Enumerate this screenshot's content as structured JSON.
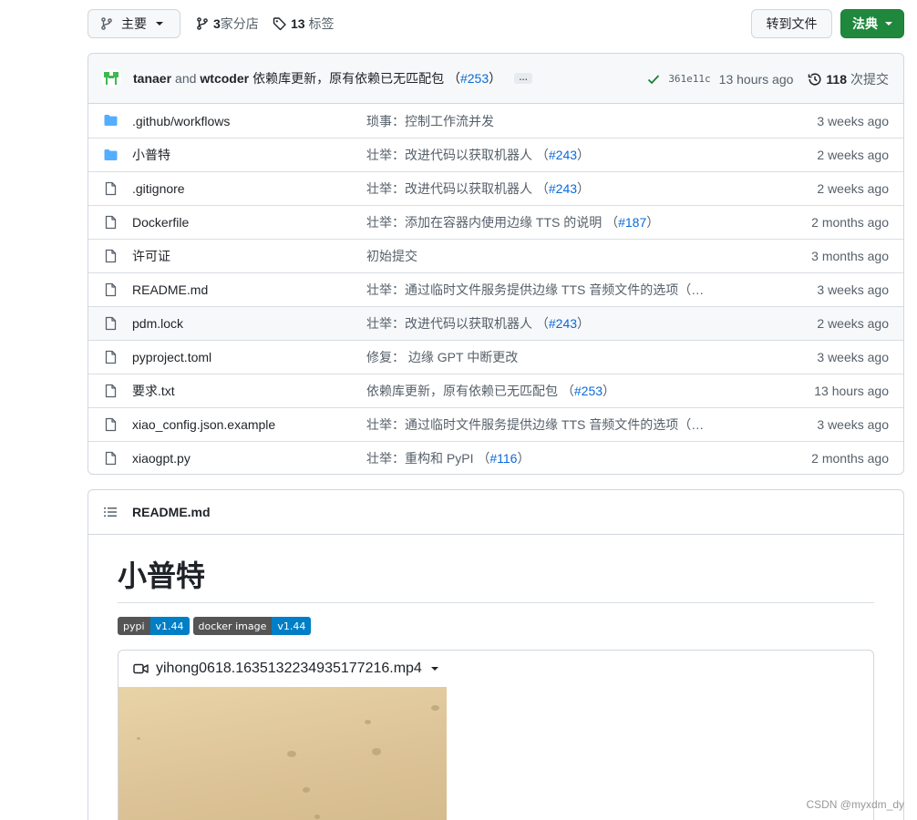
{
  "topbar": {
    "branch_label": "主要",
    "branches_count": "3",
    "branches_label": "家分店",
    "tags_count": "13",
    "tags_label": "标签",
    "goto_file_label": "转到文件",
    "code_label": "法典"
  },
  "commit": {
    "author1": "tanaer",
    "and": "and",
    "author2": "wtcoder",
    "message": "依赖库更新，原有依赖已无匹配包",
    "pr": "#253",
    "sha": "361e11c",
    "time": "13 hours ago",
    "history_count": "118",
    "history_label": "次提交"
  },
  "files": [
    {
      "type": "dir",
      "name": ".github/workflows",
      "msg": "琐事：控制工作流并发",
      "pr": "",
      "time": "3 weeks ago"
    },
    {
      "type": "dir",
      "name": "小普特",
      "msg": "壮举：改进代码以获取机器人 ",
      "pr": "#243",
      "time": "2 weeks ago"
    },
    {
      "type": "file",
      "name": ".gitignore",
      "msg": "壮举：改进代码以获取机器人 ",
      "pr": "#243",
      "time": "2 weeks ago"
    },
    {
      "type": "file",
      "name": "Dockerfile",
      "msg": "壮举：添加在容器内使用边缘 TTS 的说明 ",
      "pr": "#187",
      "time": "2 months ago"
    },
    {
      "type": "file",
      "name": "许可证",
      "msg": "初始提交",
      "pr": "",
      "time": "3 months ago"
    },
    {
      "type": "file",
      "name": "README.md",
      "msg": "壮举：通过临时文件服务提供边缘 TTS 音频文件的选项（",
      "pr": "#...",
      "time": "3 weeks ago"
    },
    {
      "type": "file",
      "name": "pdm.lock",
      "msg": "壮举：改进代码以获取机器人 ",
      "pr": "#243",
      "time": "2 weeks ago"
    },
    {
      "type": "file",
      "name": "pyproject.toml",
      "msg": "修复： 边缘 GPT 中断更改",
      "pr": "",
      "time": "3 weeks ago"
    },
    {
      "type": "file",
      "name": "要求.txt",
      "msg": "依赖库更新，原有依赖已无匹配包 ",
      "pr": "#253",
      "time": "13 hours ago"
    },
    {
      "type": "file",
      "name": "xiao_config.json.example",
      "msg": "壮举：通过临时文件服务提供边缘 TTS 音频文件的选项（",
      "pr": "#...",
      "time": "3 weeks ago"
    },
    {
      "type": "file",
      "name": "xiaogpt.py",
      "msg": "壮举：重构和 PyPI ",
      "pr": "#116",
      "time": "2 months ago"
    }
  ],
  "readme": {
    "header": "README.md",
    "title": "小普特",
    "badges": [
      {
        "left": "pypi",
        "right": "v1.44"
      },
      {
        "left": "docker image",
        "right": "v1.44"
      }
    ],
    "video_name": "yihong0618.1635132234935177216.mp4"
  },
  "watermark": "CSDN @myxdm_dy",
  "colors": {
    "accent_green": "#1f883d",
    "link_blue": "#0969da",
    "folder_blue": "#54aeff",
    "badge_blue": "#007ec6"
  }
}
